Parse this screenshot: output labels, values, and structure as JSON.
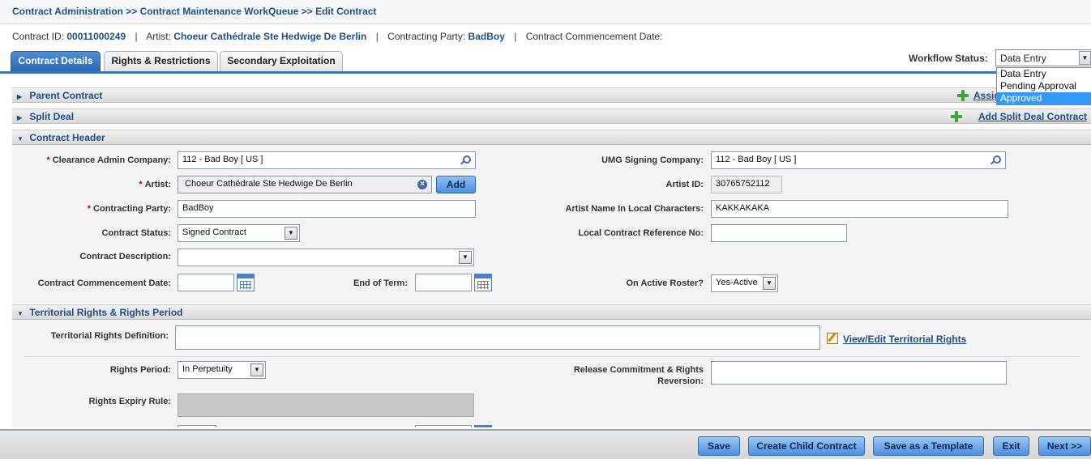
{
  "breadcrumb": {
    "text": "Contract Administration >> Contract Maintenance WorkQueue >> Edit Contract"
  },
  "info": {
    "contract_id_label": "Contract ID:",
    "contract_id": "00011000249",
    "artist_label": "Artist:",
    "artist": "Choeur Cathédrale Ste Hedwige De Berlin",
    "party_label": "Contracting Party:",
    "party": "BadBoy",
    "commencement_label": "Contract Commencement Date:",
    "separator": "|"
  },
  "tabs": [
    {
      "label": "Contract Details",
      "active": true
    },
    {
      "label": "Rights & Restrictions",
      "active": false
    },
    {
      "label": "Secondary Exploitation",
      "active": false
    }
  ],
  "workflow": {
    "label": "Workflow Status:",
    "value": "Data Entry",
    "options": [
      "Data Entry",
      "Pending Approval",
      "Approved"
    ],
    "highlighted": "Approved"
  },
  "sections": {
    "parent": {
      "title": "Parent Contract",
      "link": "Assign Parent Contract"
    },
    "split": {
      "title": "Split Deal",
      "link": "Add Split Deal Contract"
    },
    "header": {
      "title": "Contract Header"
    },
    "territorial": {
      "title": "Territorial Rights & Rights Period"
    }
  },
  "form": {
    "clearance_admin": {
      "label": "Clearance Admin Company:",
      "value": "112 - Bad Boy [ US ]"
    },
    "artist": {
      "label": "Artist:",
      "value": "Choeur Cathédrale Ste Hedwige De Berlin",
      "button": "Add"
    },
    "contracting_party": {
      "label": "Contracting Party:",
      "value": "BadBoy"
    },
    "contract_status": {
      "label": "Contract Status:",
      "value": "Signed Contract"
    },
    "contract_description": {
      "label": "Contract Description:",
      "value": ""
    },
    "commencement": {
      "label": "Contract Commencement Date:",
      "value": ""
    },
    "end_of_term": {
      "label": "End of Term:",
      "value": ""
    },
    "umg_signing": {
      "label": "UMG Signing Company:",
      "value": "112 - Bad Boy [ US ]"
    },
    "artist_id": {
      "label": "Artist ID:",
      "value": "30765752112"
    },
    "artist_local": {
      "label": "Artist Name In Local Characters:",
      "value": "KAKKAKAKA"
    },
    "local_ref": {
      "label": "Local Contract Reference No:",
      "value": ""
    },
    "active_roster": {
      "label": "On Active Roster?",
      "value": "Yes-Active"
    },
    "required_mark": "*"
  },
  "territorial_form": {
    "definition": {
      "label": "Territorial Rights Definition:",
      "value": ""
    },
    "view_edit_link": "View/Edit Territorial Rights",
    "rights_period": {
      "label": "Rights Period:",
      "value": "In Perpetuity"
    },
    "release_commitment": {
      "label_line1": "Release Commitment & Rights",
      "label_line2": "Reversion:",
      "value": ""
    },
    "expiry_rule": {
      "label": "Rights Expiry Rule:",
      "value": ""
    }
  },
  "footer": {
    "save": "Save",
    "create_child": "Create Child Contract",
    "save_template": "Save as a Template",
    "exit": "Exit",
    "next": "Next >>"
  },
  "colors": {
    "brand_blue": "#1f4e8c",
    "tab_active": "#2a67b3",
    "selected_option": "#3399ff",
    "required": "#cc0000"
  }
}
